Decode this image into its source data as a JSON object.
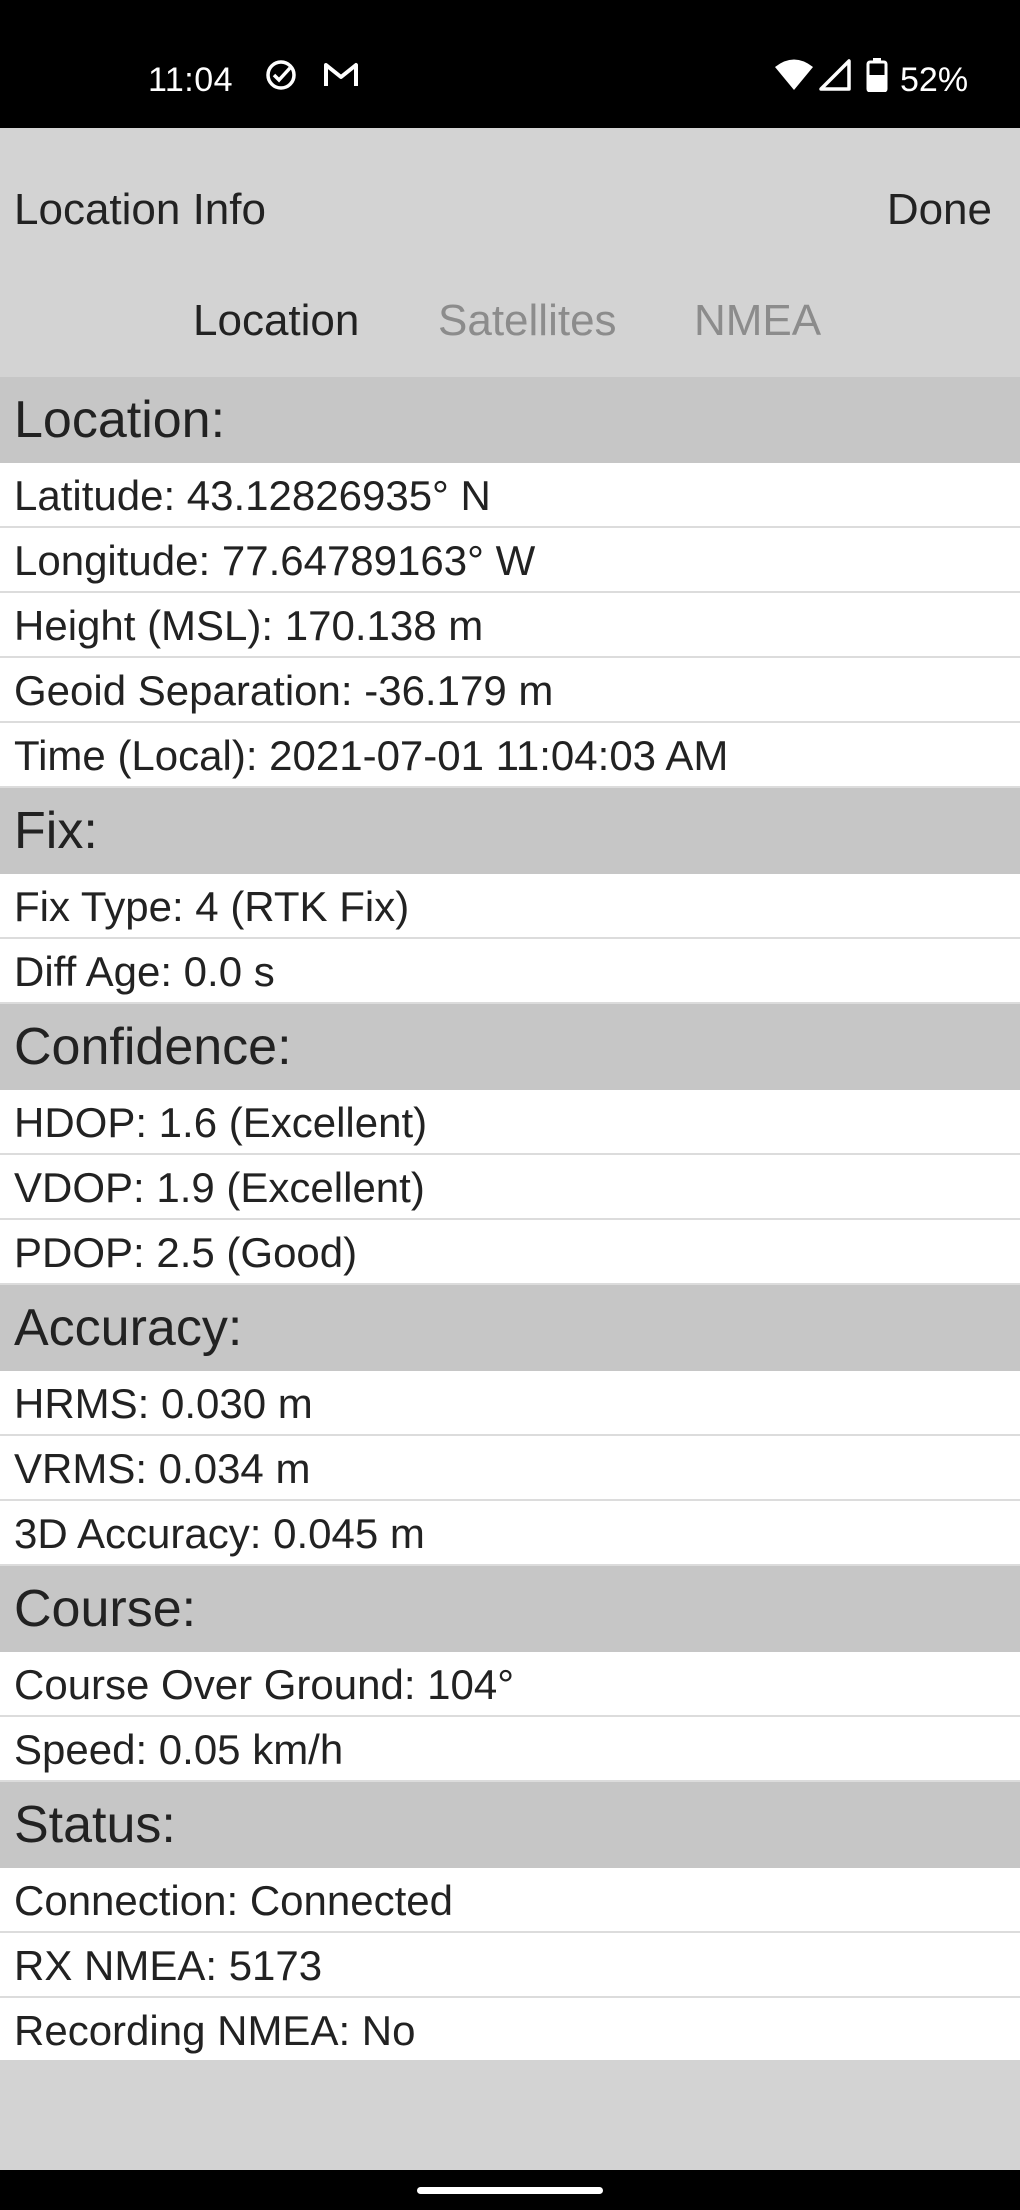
{
  "status_bar": {
    "time": "11:04",
    "battery_percent": "52%",
    "icons": [
      "check-circle-icon",
      "gmail-icon",
      "wifi-icon",
      "signal-icon",
      "battery-icon"
    ]
  },
  "header": {
    "title": "Location Info",
    "done_label": "Done",
    "tabs": [
      {
        "label": "Location",
        "active": true
      },
      {
        "label": "Satellites",
        "active": false
      },
      {
        "label": "NMEA",
        "active": false
      }
    ]
  },
  "sections": {
    "location": {
      "title": "Location:",
      "rows": [
        "Latitude: 43.12826935° N",
        "Longitude: 77.64789163° W",
        "Height (MSL): 170.138 m",
        "Geoid Separation: -36.179 m",
        "Time (Local): 2021-07-01 11:04:03 AM"
      ]
    },
    "fix": {
      "title": "Fix:",
      "rows": [
        "Fix Type: 4 (RTK Fix)",
        "Diff Age: 0.0 s"
      ]
    },
    "confidence": {
      "title": "Confidence:",
      "rows": [
        "HDOP: 1.6 (Excellent)",
        "VDOP: 1.9 (Excellent)",
        "PDOP: 2.5 (Good)"
      ]
    },
    "accuracy": {
      "title": "Accuracy:",
      "rows": [
        "HRMS: 0.030 m",
        "VRMS: 0.034 m",
        "3D Accuracy: 0.045 m"
      ]
    },
    "course": {
      "title": "Course:",
      "rows": [
        "Course Over Ground: 104°",
        "Speed: 0.05 km/h"
      ]
    },
    "status": {
      "title": "Status:",
      "rows": [
        "Connection: Connected",
        "RX NMEA: 5173",
        "Recording NMEA: No"
      ]
    }
  }
}
